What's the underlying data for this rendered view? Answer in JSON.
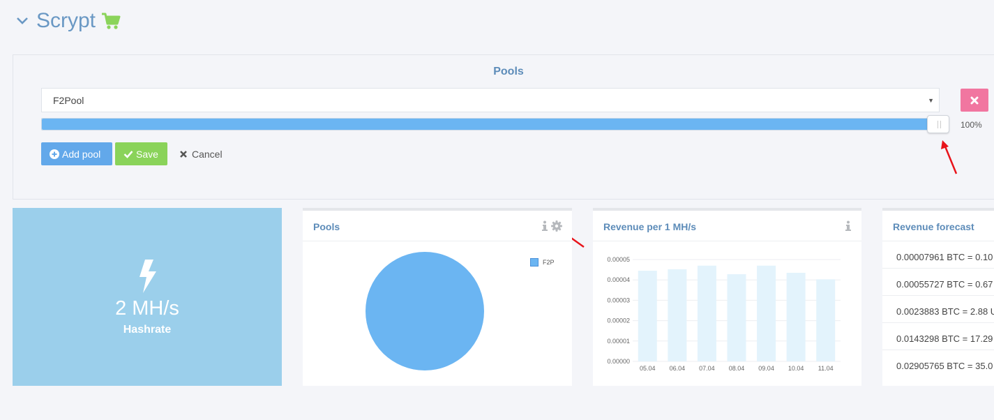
{
  "header": {
    "title": "Scrypt"
  },
  "editor": {
    "title": "Pools",
    "select_value": "F2Pool",
    "slider": {
      "percent": 100,
      "label": "100%"
    },
    "buttons": {
      "add": "Add pool",
      "save": "Save",
      "cancel": "Cancel"
    }
  },
  "hashrate": {
    "value": "2 MH/s",
    "label": "Hashrate"
  },
  "pools_card": {
    "title": "Pools",
    "legend": "F2P",
    "chart_data": {
      "type": "pie",
      "labels": [
        "F2P"
      ],
      "values": [
        100
      ],
      "colors": [
        "#6bb5f2"
      ]
    }
  },
  "revenue_card": {
    "title": "Revenue per 1 MH/s",
    "chart_data": {
      "type": "bar",
      "categories": [
        "05.04",
        "06.04",
        "07.04",
        "08.04",
        "09.04",
        "10.04",
        "11.04"
      ],
      "values": [
        4.45e-05,
        4.52e-05,
        4.7e-05,
        4.28e-05,
        4.7e-05,
        4.35e-05,
        4.03e-05
      ],
      "ylim": [
        0,
        5e-05
      ],
      "yticks": [
        "0.00000",
        "0.00001",
        "0.00002",
        "0.00003",
        "0.00004",
        "0.00005"
      ],
      "grid": true,
      "bar_color": "#e3f3fc"
    }
  },
  "forecast_card": {
    "title": "Revenue forecast",
    "rows": [
      "0.00007961 BTC = 0.10",
      "0.00055727 BTC = 0.67",
      "0.0023883 BTC = 2.88 U",
      "0.0143298 BTC = 17.29",
      "0.02905765 BTC = 35.0"
    ]
  },
  "colors": {
    "accent": "#5d8cb9",
    "danger": "#f176a0",
    "primary": "#62a8ea",
    "success": "#8ad35a"
  }
}
